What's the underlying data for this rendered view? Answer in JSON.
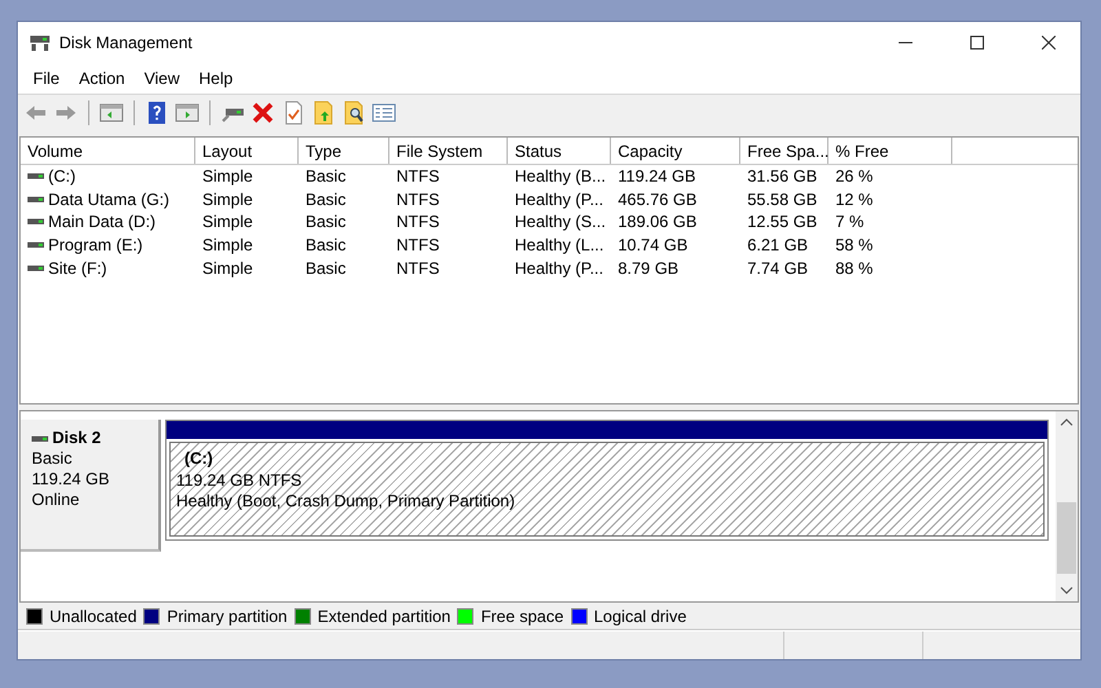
{
  "window": {
    "title": "Disk Management"
  },
  "menu": [
    "File",
    "Action",
    "View",
    "Help"
  ],
  "volumes": {
    "columns": [
      "Volume",
      "Layout",
      "Type",
      "File System",
      "Status",
      "Capacity",
      "Free Spa...",
      "% Free"
    ],
    "rows": [
      [
        "(C:)",
        "Simple",
        "Basic",
        "NTFS",
        "Healthy (B...",
        "119.24 GB",
        "31.56 GB",
        "26 %"
      ],
      [
        "Data Utama (G:)",
        "Simple",
        "Basic",
        "NTFS",
        "Healthy (P...",
        "465.76 GB",
        "55.58 GB",
        "12 %"
      ],
      [
        "Main Data (D:)",
        "Simple",
        "Basic",
        "NTFS",
        "Healthy (S...",
        "189.06 GB",
        "12.55 GB",
        "7 %"
      ],
      [
        "Program (E:)",
        "Simple",
        "Basic",
        "NTFS",
        "Healthy (L...",
        "10.74 GB",
        "6.21 GB",
        "58 %"
      ],
      [
        "Site (F:)",
        "Simple",
        "Basic",
        "NTFS",
        "Healthy (P...",
        "8.79 GB",
        "7.74 GB",
        "88 %"
      ]
    ]
  },
  "disk": {
    "name": "Disk 2",
    "type": "Basic",
    "size": "119.24 GB",
    "state": "Online",
    "partition": {
      "name": "(C:)",
      "size": "119.24 GB NTFS",
      "status": "Healthy (Boot, Crash Dump, Primary Partition)",
      "color": "#000080"
    }
  },
  "legend": [
    {
      "label": "Unallocated",
      "color": "#000000"
    },
    {
      "label": "Primary partition",
      "color": "#000080"
    },
    {
      "label": "Extended partition",
      "color": "#008000"
    },
    {
      "label": "Free space",
      "color": "#00ff00"
    },
    {
      "label": "Logical drive",
      "color": "#0000ff"
    }
  ]
}
